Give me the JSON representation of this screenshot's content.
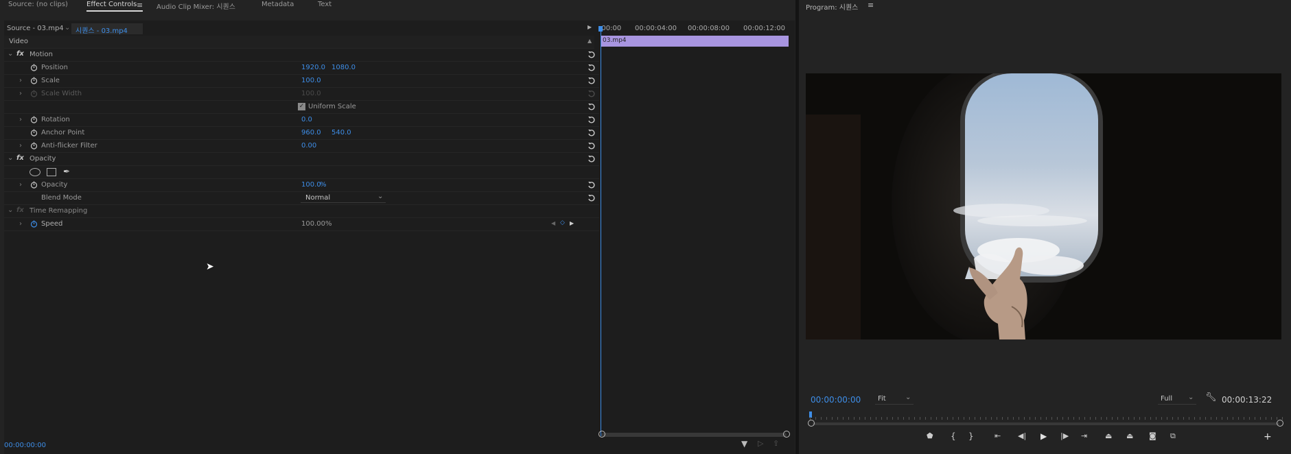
{
  "tabs": {
    "source": "Source: (no clips)",
    "effect_controls": "Effect Controls",
    "audio_mixer": "Audio Clip Mixer: 시퀀스",
    "metadata": "Metadata",
    "text": "Text"
  },
  "source_bar": {
    "master": "Source - 03.mp4",
    "sequence": "시퀀스 - 03.mp4"
  },
  "section_video": "Video",
  "effects": {
    "motion": {
      "title": "Motion",
      "position": {
        "label": "Position",
        "x": "1920.0",
        "y": "1080.0"
      },
      "scale": {
        "label": "Scale",
        "value": "100.0"
      },
      "scale_width": {
        "label": "Scale Width",
        "value": "100.0"
      },
      "uniform_scale": "Uniform Scale",
      "rotation": {
        "label": "Rotation",
        "value": "0.0"
      },
      "anchor_point": {
        "label": "Anchor Point",
        "x": "960.0",
        "y": "540.0"
      },
      "anti_flicker": {
        "label": "Anti-flicker Filter",
        "value": "0.00"
      }
    },
    "opacity": {
      "title": "Opacity",
      "opacity": {
        "label": "Opacity",
        "value": "100.0",
        "unit": "%"
      },
      "blend_mode": {
        "label": "Blend Mode",
        "value": "Normal"
      }
    },
    "time_remapping": {
      "title": "Time Remapping",
      "speed": {
        "label": "Speed",
        "value": "100.00%"
      }
    }
  },
  "timeline": {
    "ticks": [
      ":00:00",
      "00:00:04:00",
      "00:00:08:00",
      "00:00:12:00"
    ],
    "clip_name": "03.mp4"
  },
  "footer_timecode": "00:00:00:00",
  "program": {
    "title": "Program: 시퀀스",
    "timecode": "00:00:00:00",
    "fit": "Fit",
    "quality": "Full",
    "duration": "00:00:13:22"
  },
  "colors": {
    "accent": "#3e8ee8",
    "clip": "#a895e0",
    "panel": "#1d1d1d"
  }
}
